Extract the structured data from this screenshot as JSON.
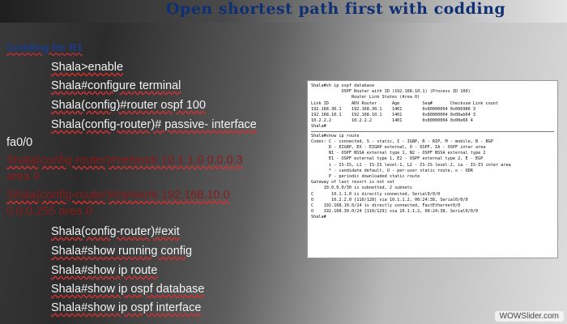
{
  "slide": {
    "title": "Open shortest path first with codding",
    "heading": "Codding for R1",
    "lines": [
      "Shala>enable",
      "Shala#configure terminal",
      "Shala(config)#router ospf 100",
      "Shala(config-router)# passive- interface",
      "fa0/0",
      "Shala(config-router)#network 10.1.1.0 0.0.0.3",
      "area 0",
      "Shala(config-router)#network 192.168.10.0",
      "0.0.0.255 area 0",
      "Shala(config-router)#exit",
      "Shala#show running config",
      "Shala#show ip route",
      "Shala#show ip ospf database",
      "Shala#show ip ospf interface"
    ]
  },
  "terminal": {
    "block1": [
      "Shala#sh ip ospf database",
      "            OSPF Router with ID (192.168.10.1) (Process ID 100)",
      "",
      "                Router Link States (Area 0)",
      "",
      "Link ID         ADV Router      Age         Seq#       Checksum Link count",
      "192.168.30.1    192.168.30.1    1401        0x80000004 0x006986 3",
      "192.168.10.1    192.168.10.1    1401        0x80000004 0x00ab64 3",
      "10.2.2.2        10.2.2.2        1401        0x80000004 0x00e66 4",
      "Shala#"
    ],
    "block2": [
      "Shala#show ip route",
      "Codes: C - connected, S - static, I - IGRP, R - RIP, M - mobile, B - BGP",
      "       D - EIGRP, EX - EIGRP external, O - OSPF, IA - OSPF inter area",
      "       N1 - OSPF NSSA external type 1, N2 - OSPF NSSA external type 2",
      "       E1 - OSPF external type 1, E2 - OSPF external type 2, E - EGP",
      "       i - IS-IS, L1 - IS-IS level-1, L2 - IS-IS level-2, ia - IS-IS inter area",
      "       * - candidate default, U - per-user static route, o - ODR",
      "       P - periodic downloaded static route",
      "",
      "Gateway of last resort is not set",
      "",
      "     10.0.0.0/30 is subnetted, 2 subnets",
      "C       10.1.1.0 is directly connected, Serial0/0/0",
      "O       10.2.2.0 [110/128] via 10.1.1.2, 00:24:38, Serial0/0/0",
      "C    192.168.10.0/24 is directly connected, FastEthernet0/0",
      "O    192.168.30.0/24 [110/129] via 10.1.1.2, 00:24:38, Serial0/0/0",
      "Shala#"
    ]
  },
  "watermark": "WOWSlider.com",
  "colors": {
    "title": "#0f2f74",
    "text": "#f3f3f3",
    "dim_text": "#8a1a1a",
    "heading": "#1a3a8a"
  }
}
